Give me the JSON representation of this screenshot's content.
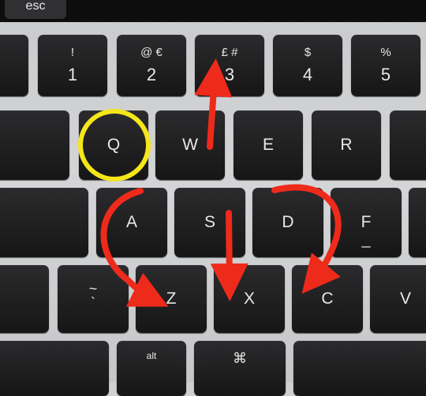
{
  "touch_bar": {
    "esc_label": "esc"
  },
  "number_row": [
    {
      "name": "key-1",
      "symbol": "!",
      "number": "1"
    },
    {
      "name": "key-2",
      "symbol": "@ €",
      "number": "2"
    },
    {
      "name": "key-3",
      "symbol": "£ #",
      "number": "3"
    },
    {
      "name": "key-4",
      "symbol": "$",
      "number": "4"
    },
    {
      "name": "key-5",
      "symbol": "%",
      "number": "5"
    }
  ],
  "qwerty_row": [
    {
      "name": "key-q",
      "label": "Q"
    },
    {
      "name": "key-w",
      "label": "W"
    },
    {
      "name": "key-e",
      "label": "E"
    },
    {
      "name": "key-r",
      "label": "R"
    }
  ],
  "home_row": [
    {
      "name": "key-a",
      "label": "A"
    },
    {
      "name": "key-s",
      "label": "S"
    },
    {
      "name": "key-d",
      "label": "D"
    },
    {
      "name": "key-f",
      "label": "F"
    }
  ],
  "bottom_row": {
    "tilde_top": "~",
    "tilde_bottom": "`",
    "keys": [
      {
        "name": "key-z",
        "label": "Z"
      },
      {
        "name": "key-x",
        "label": "X"
      },
      {
        "name": "key-c",
        "label": "C"
      },
      {
        "name": "key-v",
        "label": "V"
      }
    ]
  },
  "modifier_row": {
    "alt_label": "alt",
    "cmd_symbol": "⌘"
  },
  "annotations": {
    "circle_color": "#f5e61a",
    "arrow_color": "#ee2b1b",
    "circled_key": "Q"
  }
}
